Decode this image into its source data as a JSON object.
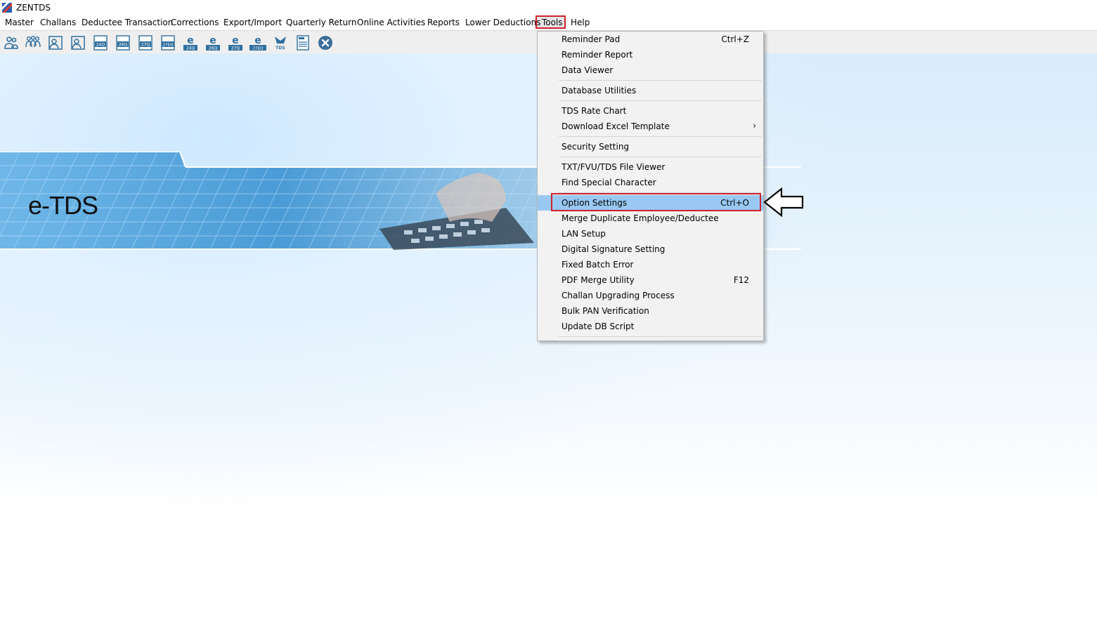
{
  "window": {
    "title": "ZENTDS"
  },
  "menubar": {
    "items": [
      "Master",
      "Challans",
      "Deductee Transaction",
      "Corrections",
      "Export/Import",
      "Quarterly Return",
      "Online Activities",
      "Reports",
      "Lower Deductions",
      "Tools",
      "Help"
    ],
    "active": "Tools"
  },
  "toolbar": {
    "buttons": [
      {
        "icon": "deductor-icon"
      },
      {
        "icon": "group-users-icon"
      },
      {
        "icon": "employee-icon"
      },
      {
        "icon": "deductee-icon"
      },
      {
        "icon": "form-24q-icon",
        "label": "24Q"
      },
      {
        "icon": "form-26q-icon",
        "label": "26Q"
      },
      {
        "icon": "form-27q-icon",
        "label": "27Q"
      },
      {
        "icon": "form-27eq-icon",
        "label": "27EQ"
      },
      {
        "icon": "e-24q-icon",
        "label": "24Q"
      },
      {
        "icon": "e-26q-icon",
        "label": "26Q"
      },
      {
        "icon": "e-27q-icon",
        "label": "27Q"
      },
      {
        "icon": "e-27eq-icon",
        "label": "27EQ"
      },
      {
        "icon": "tds-icon",
        "label": "TDS"
      },
      {
        "icon": "report-icon"
      },
      {
        "icon": "close-circle-icon"
      }
    ]
  },
  "banner": {
    "label": "e-TDS"
  },
  "tools_menu": {
    "items": [
      {
        "label": "Reminder Pad",
        "shortcut": "Ctrl+Z"
      },
      {
        "label": "Reminder Report",
        "shortcut": ""
      },
      {
        "label": "Data Viewer",
        "shortcut": ""
      },
      {
        "label": "Database Utilities",
        "shortcut": ""
      },
      {
        "label": "TDS Rate Chart",
        "shortcut": ""
      },
      {
        "label": "Download Excel Template",
        "shortcut": "",
        "submenu": true
      },
      {
        "label": "Security Setting",
        "shortcut": ""
      },
      {
        "label": "TXT/FVU/TDS File Viewer",
        "shortcut": ""
      },
      {
        "label": "Find Special Character",
        "shortcut": ""
      },
      {
        "label": "Option Settings",
        "shortcut": "Ctrl+O",
        "highlighted": true
      },
      {
        "label": "Merge Duplicate Employee/Deductee",
        "shortcut": ""
      },
      {
        "label": "LAN Setup",
        "shortcut": ""
      },
      {
        "label": "Digital Signature Setting",
        "shortcut": ""
      },
      {
        "label": "Fixed Batch Error",
        "shortcut": ""
      },
      {
        "label": "PDF Merge Utility",
        "shortcut": "F12"
      },
      {
        "label": "Challan Upgrading Process",
        "shortcut": ""
      },
      {
        "label": "Bulk PAN Verification",
        "shortcut": ""
      },
      {
        "label": "Update DB Script",
        "shortcut": ""
      }
    ]
  },
  "colors": {
    "highlight": "#99c9f3",
    "annotation": "#d0202e",
    "icon_blue": "#2f6f9f"
  }
}
